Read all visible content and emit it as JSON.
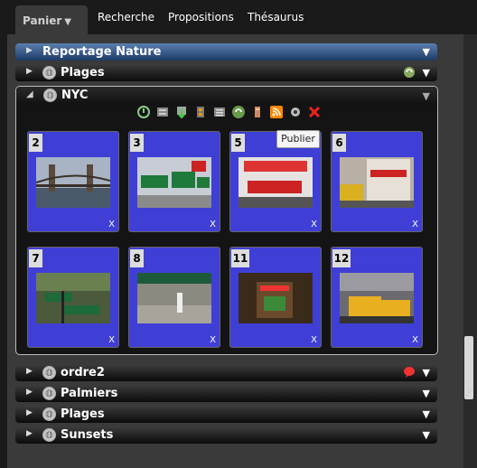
{
  "tabs": {
    "panier": "Panier",
    "recherche": "Recherche",
    "propositions": "Propositions",
    "thesaurus": "Thésaurus"
  },
  "rows": {
    "reportage": "Reportage Nature",
    "plages1": "Plages",
    "nyc": "NYC",
    "ordre2": "ordre2",
    "palmiers": "Palmiers",
    "plages2": "Plages",
    "sunsets": "Sunsets"
  },
  "tooltip": "Publier",
  "cards": [
    {
      "num": "2",
      "x": "X"
    },
    {
      "num": "3",
      "x": "X"
    },
    {
      "num": "5",
      "x": "X"
    },
    {
      "num": "6",
      "x": "X"
    },
    {
      "num": "7",
      "x": "X"
    },
    {
      "num": "8",
      "x": "X"
    },
    {
      "num": "11",
      "x": "X"
    },
    {
      "num": "12",
      "x": "X"
    }
  ],
  "colors": {
    "card": "#3f3fd6",
    "panel": "#3a3a3a",
    "blue_row": "#2d5590"
  },
  "icons": {
    "toolbar": [
      "refresh-icon",
      "print-icon",
      "download-icon",
      "archive-icon",
      "list-icon",
      "refresh-green-icon",
      "bookmark-icon",
      "rss-icon",
      "settings-icon",
      "delete-icon"
    ]
  }
}
